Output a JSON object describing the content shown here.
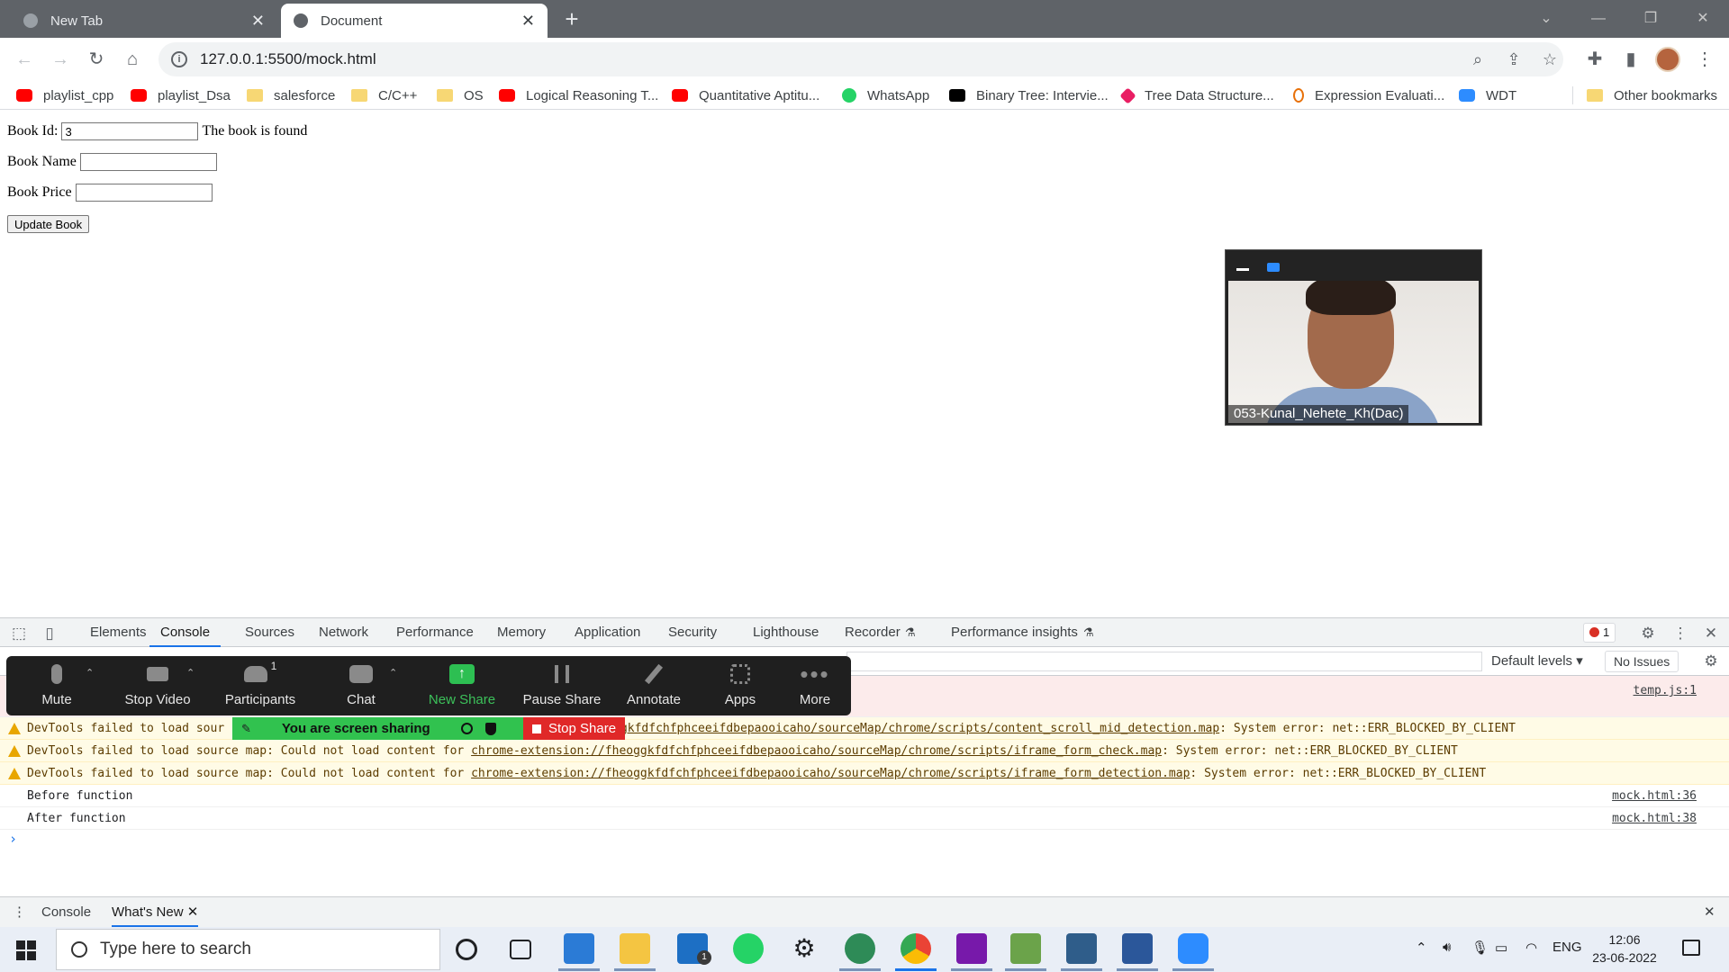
{
  "tabs": [
    {
      "title": "New Tab",
      "active": false
    },
    {
      "title": "Document",
      "active": true
    }
  ],
  "toolbar": {
    "url": "127.0.0.1:5500/mock.html"
  },
  "bookmarks": [
    {
      "label": "playlist_cpp",
      "icon": "youtube-icon"
    },
    {
      "label": "playlist_Dsa",
      "icon": "youtube-icon"
    },
    {
      "label": "salesforce",
      "icon": "folder-icon"
    },
    {
      "label": "C/C++",
      "icon": "folder-icon"
    },
    {
      "label": "OS",
      "icon": "folder-icon"
    },
    {
      "label": "Logical Reasoning T...",
      "icon": "youtube-icon"
    },
    {
      "label": "Quantitative Aptitu...",
      "icon": "youtube-icon"
    },
    {
      "label": "WhatsApp",
      "icon": "whatsapp-icon"
    },
    {
      "label": "Binary Tree: Intervie...",
      "icon": "medium-icon"
    },
    {
      "label": "Tree Data Structure...",
      "icon": "cube-icon"
    },
    {
      "label": "Expression Evaluati...",
      "icon": "gfg-icon"
    },
    {
      "label": "WDT",
      "icon": "zoom-icon"
    }
  ],
  "other_bookmarks": "Other bookmarks",
  "page": {
    "book_id_label": "Book Id:",
    "book_id_value": "3",
    "book_found_msg": "The book is found",
    "book_name_label": "Book Name",
    "book_name_value": "",
    "book_price_label": "Book Price",
    "book_price_value": "",
    "update_button": "Update Book"
  },
  "video": {
    "participant_name": "053-Kunal_Nehete_Kh(Dac)"
  },
  "devtools": {
    "tabs": [
      "Elements",
      "Console",
      "Sources",
      "Network",
      "Performance",
      "Memory",
      "Application",
      "Security",
      "Lighthouse",
      "Recorder",
      "Performance insights"
    ],
    "active_tab": "Console",
    "error_count": "1",
    "levels": "Default levels",
    "issues": "No Issues",
    "messages": [
      {
        "type": "error",
        "text": "",
        "source": "temp.js:1"
      },
      {
        "type": "warning",
        "prefix": "DevTools failed to load sour",
        "link": "//fheoggkfdfchfphceeifdbepaooicaho/sourceMap/chrome/scripts/content_scroll_mid_detection.map",
        "suffix": ": System error: net::ERR_BLOCKED_BY_CLIENT"
      },
      {
        "type": "warning",
        "prefix": "DevTools failed to load source map: Could not load content for ",
        "link": "chrome-extension://fheoggkfdfchfphceeifdbepaooicaho/sourceMap/chrome/scripts/iframe_form_check.map",
        "suffix": ": System error: net::ERR_BLOCKED_BY_CLIENT"
      },
      {
        "type": "warning",
        "prefix": "DevTools failed to load source map: Could not load content for ",
        "link": "chrome-extension://fheoggkfdfchfphceeifdbepaooicaho/sourceMap/chrome/scripts/iframe_form_detection.map",
        "suffix": ": System error: net::ERR_BLOCKED_BY_CLIENT"
      },
      {
        "type": "log",
        "text": "Before function",
        "source": "mock.html:36"
      },
      {
        "type": "log",
        "text": "After function",
        "source": "mock.html:38"
      }
    ],
    "drawer_tabs": [
      "Console",
      "What's New"
    ]
  },
  "zoom": {
    "buttons": [
      "Mute",
      "Stop Video",
      "Participants",
      "Chat",
      "New Share",
      "Pause Share",
      "Annotate",
      "Apps",
      "More"
    ],
    "participant_count": "1",
    "sharing_text": "You are screen sharing",
    "stop_share": "Stop Share"
  },
  "taskbar": {
    "search_placeholder": "Type here to search",
    "language": "ENG",
    "time": "12:06",
    "date": "23-06-2022",
    "mail_badge": "1"
  },
  "colors": {
    "tab_strip": "#5f6368",
    "devtools_active": "#1a73e8",
    "zoom_share_green": "#31c24f",
    "zoom_stop_red": "#e02828"
  }
}
